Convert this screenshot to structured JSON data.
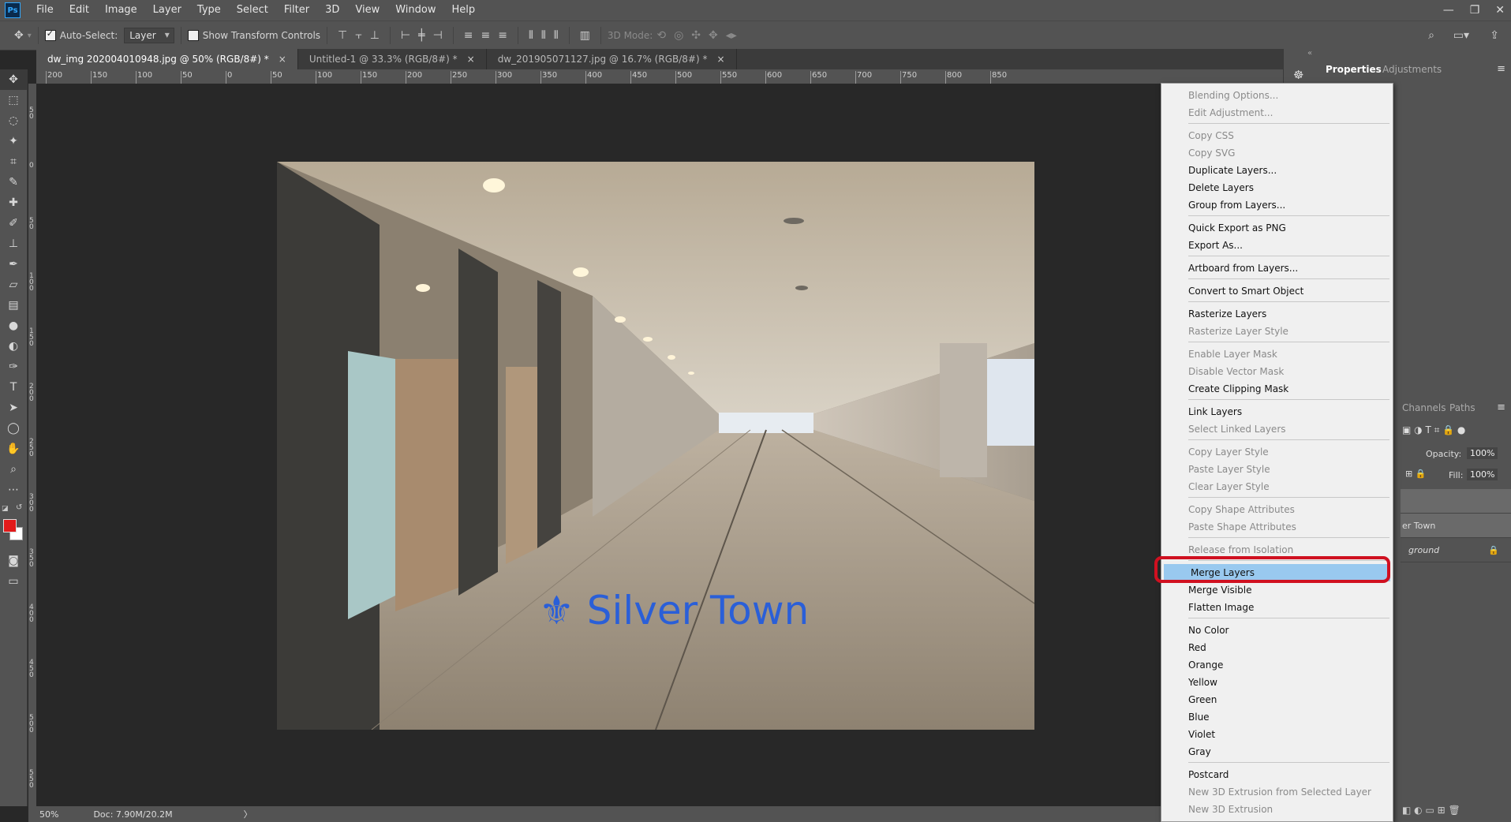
{
  "app": {
    "logo": "Ps"
  },
  "menu": [
    "File",
    "Edit",
    "Image",
    "Layer",
    "Type",
    "Select",
    "Filter",
    "3D",
    "View",
    "Window",
    "Help"
  ],
  "options_bar": {
    "auto_select_label": "Auto-Select:",
    "auto_select_checked": true,
    "auto_select_value": "Layer",
    "show_transform_label": "Show Transform Controls",
    "show_transform_checked": false,
    "mode_3d_label": "3D Mode:"
  },
  "tabs": [
    {
      "label": "dw_img 202004010948.jpg @ 50% (RGB/8#) *",
      "active": true
    },
    {
      "label": "Untitled-1 @ 33.3% (RGB/8#) *",
      "active": false
    },
    {
      "label": "dw_201905071127.jpg @ 16.7% (RGB/8#) *",
      "active": false
    }
  ],
  "ruler_h_labels": [
    "200",
    "150",
    "100",
    "50",
    "0",
    "50",
    "100",
    "150",
    "200",
    "250",
    "300",
    "350",
    "400",
    "450",
    "500",
    "550",
    "600",
    "650",
    "700",
    "750",
    "800",
    "850"
  ],
  "ruler_v_labels": [
    "5 0",
    "0",
    "5 0",
    "1 0 0",
    "1 5 0",
    "2 0 0",
    "2 5 0",
    "3 0 0",
    "3 5 0",
    "4 0 0",
    "4 5 0",
    "5 0 0",
    "5 5 0"
  ],
  "canvas": {
    "watermark_symbol": "⚜",
    "watermark_text": "Silver Town"
  },
  "status": {
    "zoom": "50%",
    "doc": "Doc: 7.90M/20.2M"
  },
  "right_panel": {
    "tabs": [
      "Properties",
      "Adjustments"
    ],
    "active_tab": "Properties",
    "layers_tabs": [
      "Channels",
      "Paths"
    ],
    "opacity_label": "Opacity:",
    "opacity_value": "100%",
    "fill_label": "Fill:",
    "fill_value": "100%",
    "layer_rows": [
      "er Town",
      "ground"
    ]
  },
  "context_menu": {
    "items": [
      {
        "label": "Blending Options...",
        "enabled": false
      },
      {
        "label": "Edit Adjustment...",
        "enabled": false
      },
      {
        "sep": true
      },
      {
        "label": "Copy CSS",
        "enabled": false
      },
      {
        "label": "Copy SVG",
        "enabled": false
      },
      {
        "label": "Duplicate Layers...",
        "enabled": true
      },
      {
        "label": "Delete Layers",
        "enabled": true
      },
      {
        "label": "Group from Layers...",
        "enabled": true
      },
      {
        "sep": true
      },
      {
        "label": "Quick Export as PNG",
        "enabled": true
      },
      {
        "label": "Export As...",
        "enabled": true
      },
      {
        "sep": true
      },
      {
        "label": "Artboard from Layers...",
        "enabled": true
      },
      {
        "sep": true
      },
      {
        "label": "Convert to Smart Object",
        "enabled": true
      },
      {
        "sep": true
      },
      {
        "label": "Rasterize Layers",
        "enabled": true
      },
      {
        "label": "Rasterize Layer Style",
        "enabled": false
      },
      {
        "sep": true
      },
      {
        "label": "Enable Layer Mask",
        "enabled": false
      },
      {
        "label": "Disable Vector Mask",
        "enabled": false
      },
      {
        "label": "Create Clipping Mask",
        "enabled": true
      },
      {
        "sep": true
      },
      {
        "label": "Link Layers",
        "enabled": true
      },
      {
        "label": "Select Linked Layers",
        "enabled": false
      },
      {
        "sep": true
      },
      {
        "label": "Copy Layer Style",
        "enabled": false
      },
      {
        "label": "Paste Layer Style",
        "enabled": false
      },
      {
        "label": "Clear Layer Style",
        "enabled": false
      },
      {
        "sep": true
      },
      {
        "label": "Copy Shape Attributes",
        "enabled": false
      },
      {
        "label": "Paste Shape Attributes",
        "enabled": false
      },
      {
        "sep": true
      },
      {
        "label": "Release from Isolation",
        "enabled": false
      },
      {
        "sep": true
      },
      {
        "label": "Merge Layers",
        "enabled": true,
        "highlighted": true
      },
      {
        "label": "Merge Visible",
        "enabled": true
      },
      {
        "label": "Flatten Image",
        "enabled": true
      },
      {
        "sep": true
      },
      {
        "label": "No Color",
        "enabled": true
      },
      {
        "label": "Red",
        "enabled": true
      },
      {
        "label": "Orange",
        "enabled": true
      },
      {
        "label": "Yellow",
        "enabled": true
      },
      {
        "label": "Green",
        "enabled": true
      },
      {
        "label": "Blue",
        "enabled": true
      },
      {
        "label": "Violet",
        "enabled": true
      },
      {
        "label": "Gray",
        "enabled": true
      },
      {
        "sep": true
      },
      {
        "label": "Postcard",
        "enabled": true
      },
      {
        "label": "New 3D Extrusion from Selected Layer",
        "enabled": false
      },
      {
        "label": "New 3D Extrusion",
        "enabled": false
      }
    ]
  },
  "colors": {
    "foreground": "#e11a1a",
    "background": "#ffffff",
    "highlight": "#99c9ef",
    "annotation_ring": "#d01020",
    "watermark": "#2a5fd8"
  }
}
